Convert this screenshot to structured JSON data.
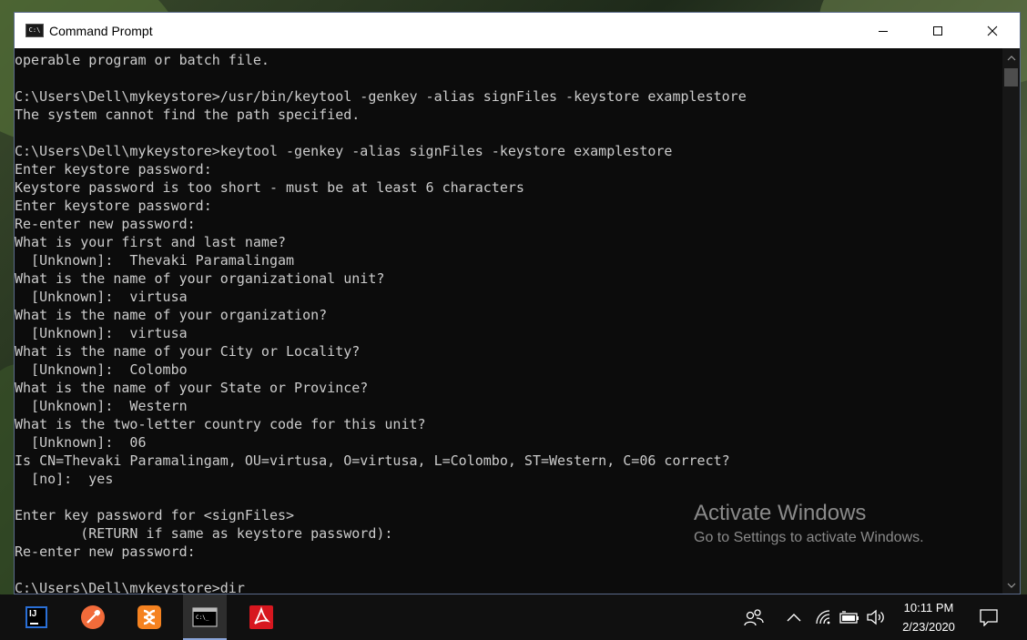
{
  "window": {
    "title": "Command Prompt",
    "app_icon_text": "C:\\"
  },
  "console": {
    "lines": [
      "operable program or batch file.",
      "",
      "C:\\Users\\Dell\\mykeystore>/usr/bin/keytool -genkey -alias signFiles -keystore examplestore",
      "The system cannot find the path specified.",
      "",
      "C:\\Users\\Dell\\mykeystore>keytool -genkey -alias signFiles -keystore examplestore",
      "Enter keystore password:",
      "Keystore password is too short - must be at least 6 characters",
      "Enter keystore password:",
      "Re-enter new password:",
      "What is your first and last name?",
      "  [Unknown]:  Thevaki Paramalingam",
      "What is the name of your organizational unit?",
      "  [Unknown]:  virtusa",
      "What is the name of your organization?",
      "  [Unknown]:  virtusa",
      "What is the name of your City or Locality?",
      "  [Unknown]:  Colombo",
      "What is the name of your State or Province?",
      "  [Unknown]:  Western",
      "What is the two-letter country code for this unit?",
      "  [Unknown]:  06",
      "Is CN=Thevaki Paramalingam, OU=virtusa, O=virtusa, L=Colombo, ST=Western, C=06 correct?",
      "  [no]:  yes",
      "",
      "Enter key password for <signFiles>",
      "        (RETURN if same as keystore password):",
      "Re-enter new password:",
      "",
      "C:\\Users\\Dell\\mykeystore>dir"
    ]
  },
  "watermark": {
    "title": "Activate Windows",
    "subtitle": "Go to Settings to activate Windows."
  },
  "taskbar": {
    "apps": [
      {
        "name": "intellij-idea",
        "icon_text": "IJ"
      },
      {
        "name": "postman"
      },
      {
        "name": "xampp"
      },
      {
        "name": "command-prompt"
      },
      {
        "name": "acrobat-reader"
      }
    ],
    "clock": {
      "time": "10:11 PM",
      "date": "2/23/2020"
    }
  },
  "colors": {
    "console_bg": "#0c0c0c",
    "console_text": "#cccccc",
    "taskbar_bg": "#101010",
    "watermark_text": "#8a8a8a"
  }
}
